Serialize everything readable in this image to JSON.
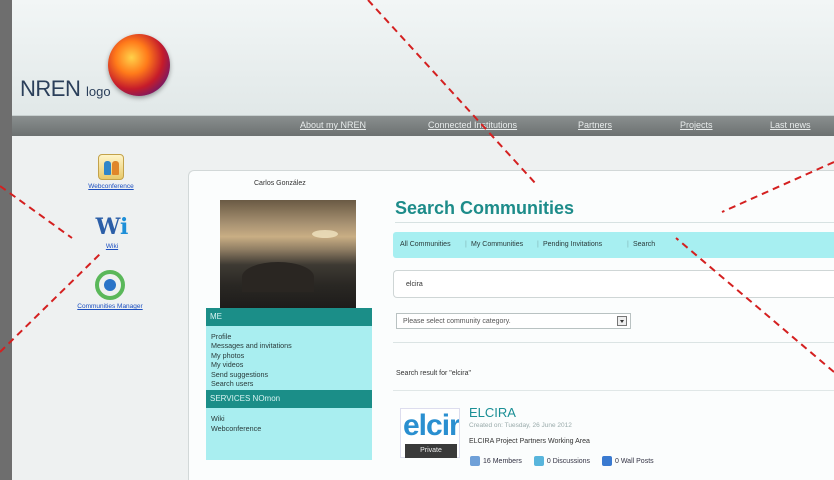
{
  "header": {
    "logo_main": "NREN",
    "logo_small": "logo"
  },
  "nav": {
    "items": [
      "About my NREN",
      "Connected Institutions",
      "Partners",
      "Projects",
      "Last news"
    ]
  },
  "apps": {
    "webconference": "Webconference",
    "wiki": "Wiki",
    "communities_manager": "Communities Manager"
  },
  "profile": {
    "name": "Carlos González",
    "menu_me_title": "ME",
    "menu_me_items": [
      "Profile",
      "Messages and invitations",
      "My photos",
      "My videos",
      "Send suggestions",
      "Search users"
    ],
    "menu_services_title": "SERVICES NOmon",
    "menu_services_items": [
      "Wiki",
      "Webconference"
    ]
  },
  "search": {
    "title": "Search Communities",
    "tabs": [
      "All Communities",
      "My Communities",
      "Pending Invitations",
      "Search"
    ],
    "query": "elcira",
    "category_placeholder": "Please select community category.",
    "result_label": "Search result for \"elcira\""
  },
  "result": {
    "logo_text": "elcir",
    "badge": "Private",
    "name": "ELCIRA",
    "created": "Created on: Tuesday, 26 June 2012",
    "description": "ELCIRA Project Partners Working Area",
    "members": "16 Members",
    "discussions": "0 Discussions",
    "wall_posts": "0 Wall Posts"
  },
  "colors": {
    "accent_teal": "#1d8c8a",
    "tab_bg": "#a7eff1",
    "menu_head": "#1b8e88",
    "annotation_red": "#d42020"
  }
}
